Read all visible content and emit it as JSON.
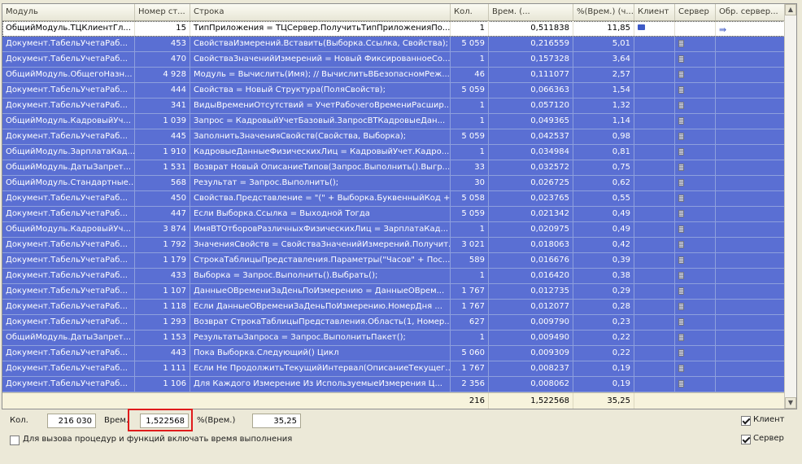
{
  "columns": [
    "Модуль",
    "Номер ст...",
    "Строка",
    "Кол.",
    "Врем. (...",
    "%(Врем.) (ч...",
    "Клиент",
    "Сервер",
    "Обр. сервер..."
  ],
  "rows": [
    {
      "module": "ОбщийМодуль.ТЦКлиентГл...",
      "line": "15",
      "text": "ТипПриложения = ТЦСервер.ПолучитьТипПриложенияПо...",
      "count": "1",
      "time": "0,511838",
      "pct": "11,85",
      "client": "monitor-icon",
      "server": "",
      "srvcall": "server-call-icon",
      "current": true
    },
    {
      "module": "Документ.ТабельУчетаРаб...",
      "line": "453",
      "text": "СвойстваИзмерений.Вставить(Выборка.Ссылка, Свойства);",
      "count": "5 059",
      "time": "0,216559",
      "pct": "5,01",
      "client": "",
      "server": "server-icon",
      "srvcall": ""
    },
    {
      "module": "Документ.ТабельУчетаРаб...",
      "line": "470",
      "text": "СвойстваЗначенийИзмерений = Новый ФиксированноеСо...",
      "count": "1",
      "time": "0,157328",
      "pct": "3,64",
      "client": "",
      "server": "server-icon",
      "srvcall": ""
    },
    {
      "module": "ОбщийМодуль.ОбщегоНазн...",
      "line": "4 928",
      "text": "Модуль = Вычислить(Имя); // ВычислитьВБезопасномРеж...",
      "count": "46",
      "time": "0,111077",
      "pct": "2,57",
      "client": "",
      "server": "server-icon",
      "srvcall": ""
    },
    {
      "module": "Документ.ТабельУчетаРаб...",
      "line": "444",
      "text": "Свойства = Новый Структура(ПоляСвойств);",
      "count": "5 059",
      "time": "0,066363",
      "pct": "1,54",
      "client": "",
      "server": "server-icon",
      "srvcall": ""
    },
    {
      "module": "Документ.ТабельУчетаРаб...",
      "line": "341",
      "text": "ВидыВремениОтсутствий = УчетРабочегоВремениРасшир...",
      "count": "1",
      "time": "0,057120",
      "pct": "1,32",
      "client": "",
      "server": "server-icon",
      "srvcall": ""
    },
    {
      "module": "ОбщийМодуль.КадровыйУч...",
      "line": "1 039",
      "text": "Запрос = КадровыйУчетБазовый.ЗапросВТКадровыеДан...",
      "count": "1",
      "time": "0,049365",
      "pct": "1,14",
      "client": "",
      "server": "server-icon",
      "srvcall": ""
    },
    {
      "module": "Документ.ТабельУчетаРаб...",
      "line": "445",
      "text": "ЗаполнитьЗначенияСвойств(Свойства, Выборка);",
      "count": "5 059",
      "time": "0,042537",
      "pct": "0,98",
      "client": "",
      "server": "server-icon",
      "srvcall": ""
    },
    {
      "module": "ОбщийМодуль.ЗарплатаКад...",
      "line": "1 910",
      "text": "КадровыеДанныеФизическихЛиц = КадровыйУчет.Кадро...",
      "count": "1",
      "time": "0,034984",
      "pct": "0,81",
      "client": "",
      "server": "server-icon",
      "srvcall": ""
    },
    {
      "module": "ОбщийМодуль.ДатыЗапрет...",
      "line": "1 531",
      "text": "Возврат Новый ОписаниеТипов(Запрос.Выполнить().Выгр...",
      "count": "33",
      "time": "0,032572",
      "pct": "0,75",
      "client": "",
      "server": "server-icon",
      "srvcall": ""
    },
    {
      "module": "ОбщийМодуль.Стандартные...",
      "line": "568",
      "text": "Результат = Запрос.Выполнить();",
      "count": "30",
      "time": "0,026725",
      "pct": "0,62",
      "client": "",
      "server": "server-icon",
      "srvcall": ""
    },
    {
      "module": "Документ.ТабельУчетаРаб...",
      "line": "450",
      "text": "Свойства.Представление = \"(\" + Выборка.БуквенныйКод +...",
      "count": "5 058",
      "time": "0,023765",
      "pct": "0,55",
      "client": "",
      "server": "server-icon",
      "srvcall": ""
    },
    {
      "module": "Документ.ТабельУчетаРаб...",
      "line": "447",
      "text": "Если Выборка.Ссылка = Выходной Тогда",
      "count": "5 059",
      "time": "0,021342",
      "pct": "0,49",
      "client": "",
      "server": "server-icon",
      "srvcall": ""
    },
    {
      "module": "ОбщийМодуль.КадровыйУч...",
      "line": "3 874",
      "text": "ИмяВТОтборовРазличныхФизическихЛиц = ЗарплатаКад...",
      "count": "1",
      "time": "0,020975",
      "pct": "0,49",
      "client": "",
      "server": "server-icon",
      "srvcall": ""
    },
    {
      "module": "Документ.ТабельУчетаРаб...",
      "line": "1 792",
      "text": "ЗначенияСвойств = СвойстваЗначенийИзмерений.Получит...",
      "count": "3 021",
      "time": "0,018063",
      "pct": "0,42",
      "client": "",
      "server": "server-icon",
      "srvcall": ""
    },
    {
      "module": "Документ.ТабельУчетаРаб...",
      "line": "1 179",
      "text": "СтрокаТаблицыПредставления.Параметры(\"Часов\" + Пос...",
      "count": "589",
      "time": "0,016676",
      "pct": "0,39",
      "client": "",
      "server": "server-icon",
      "srvcall": ""
    },
    {
      "module": "Документ.ТабельУчетаРаб...",
      "line": "433",
      "text": "Выборка = Запрос.Выполнить().Выбрать();",
      "count": "1",
      "time": "0,016420",
      "pct": "0,38",
      "client": "",
      "server": "server-icon",
      "srvcall": ""
    },
    {
      "module": "Документ.ТабельУчетаРаб...",
      "line": "1 107",
      "text": "ДанныеОВремениЗаДеньПоИзмерению = ДанныеОВрем...",
      "count": "1 767",
      "time": "0,012735",
      "pct": "0,29",
      "client": "",
      "server": "server-icon",
      "srvcall": ""
    },
    {
      "module": "Документ.ТабельУчетаРаб...",
      "line": "1 118",
      "text": "Если ДанныеОВремениЗаДеньПоИзмерению.НомерДня ...",
      "count": "1 767",
      "time": "0,012077",
      "pct": "0,28",
      "client": "",
      "server": "server-icon",
      "srvcall": ""
    },
    {
      "module": "Документ.ТабельУчетаРаб...",
      "line": "1 293",
      "text": "Возврат СтрокаТаблицыПредставления.Область(1, Номер...",
      "count": "627",
      "time": "0,009790",
      "pct": "0,23",
      "client": "",
      "server": "server-icon",
      "srvcall": ""
    },
    {
      "module": "ОбщийМодуль.ДатыЗапрет...",
      "line": "1 153",
      "text": "РезультатыЗапроса = Запрос.ВыполнитьПакет();",
      "count": "1",
      "time": "0,009490",
      "pct": "0,22",
      "client": "",
      "server": "server-icon",
      "srvcall": ""
    },
    {
      "module": "Документ.ТабельУчетаРаб...",
      "line": "443",
      "text": "Пока Выборка.Следующий() Цикл",
      "count": "5 060",
      "time": "0,009309",
      "pct": "0,22",
      "client": "",
      "server": "server-icon",
      "srvcall": ""
    },
    {
      "module": "Документ.ТабельУчетаРаб...",
      "line": "1 111",
      "text": "Если Не ПродолжитьТекущийИнтервал(ОписаниеТекущег...",
      "count": "1 767",
      "time": "0,008237",
      "pct": "0,19",
      "client": "",
      "server": "server-icon",
      "srvcall": ""
    },
    {
      "module": "Документ.ТабельУчетаРаб...",
      "line": "1 106",
      "text": "Для Каждого Измерение Из ИспользуемыеИзмерения Ц...",
      "count": "2 356",
      "time": "0,008062",
      "pct": "0,19",
      "client": "",
      "server": "server-icon",
      "srvcall": ""
    }
  ],
  "totals": {
    "count": "216 030",
    "time": "1,522568",
    "pct": "35,25"
  },
  "footer": {
    "count_label": "Кол.",
    "count_value": "216 030",
    "time_label": "Врем.",
    "time_value": "1,522568",
    "pct_label": "%(Врем.)",
    "pct_value": "35,25",
    "include_time_label": "Для вызова процедур и функций включать время выполнения",
    "include_time_checked": false,
    "client_label": "Клиент",
    "client_checked": true,
    "server_label": "Сервер",
    "server_checked": true
  },
  "colors": {
    "selection": "#5a6fd3",
    "highlight_box": "#e01b1b"
  }
}
